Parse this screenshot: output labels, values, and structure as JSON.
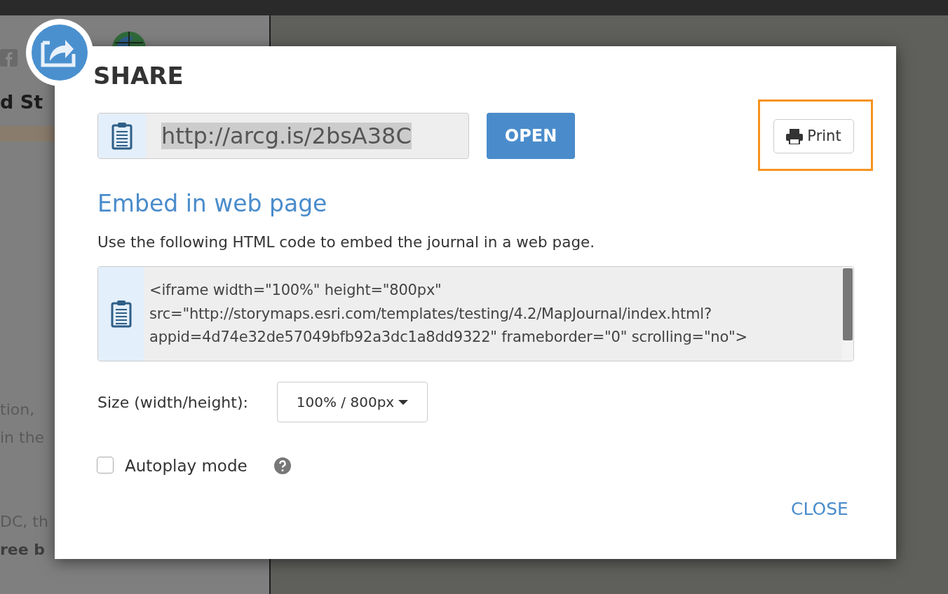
{
  "background": {
    "heading": "d St",
    "paragraphs": [
      {
        "text": "tion,",
        "bold": false
      },
      {
        "text": "in the",
        "bold": false
      },
      {
        "text": "DC, th",
        "bold": false
      },
      {
        "text": "ree b",
        "bold": true
      }
    ]
  },
  "dialog": {
    "title": "SHARE",
    "link": {
      "value": "http://arcg.is/2bsA38C",
      "selected": true
    },
    "open_button": "OPEN",
    "print_button": {
      "label": "Print",
      "highlighted": true
    },
    "embed_heading": "Embed in web page",
    "embed_description": "Use the following HTML code to embed the journal in a web page.",
    "embed_code": [
      "<iframe width=\"100%\" height=\"800px\"",
      "src=\"http://storymaps.esri.com/templates/testing/4.2/MapJournal/index.html?",
      "appid=4d74e32de57049bfb92a3dc1a8dd9322\" frameborder=\"0\" scrolling=\"no\">"
    ],
    "size_label": "Size (width/height):",
    "size_value": "100% / 800px",
    "autoplay": {
      "label": "Autoplay mode",
      "checked": false
    },
    "close_button": "CLOSE"
  }
}
